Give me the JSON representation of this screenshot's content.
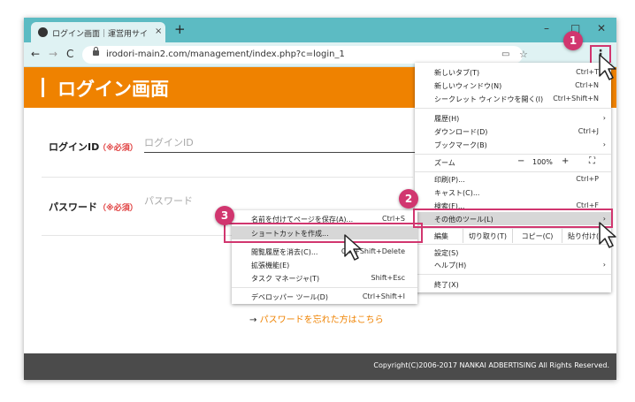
{
  "browser": {
    "tab_title": "ログイン画面｜運営用サイト｜保管",
    "tab_close": "×",
    "new_tab": "+",
    "window_controls": [
      "–",
      "□",
      "✕"
    ],
    "back": "←",
    "forward": "→",
    "reload": "C",
    "url": "irodori-main2.com/management/index.php?c=login_1",
    "star": "☆",
    "cast": "▭",
    "menu_button": "⋮"
  },
  "page": {
    "heading": "ログイン画面",
    "login_id_label": "ログインID",
    "login_id_required": "（※必須）",
    "login_id_placeholder": "ログインID",
    "password_label": "パスワード",
    "password_required": "（※必須）",
    "password_placeholder": "パスワード",
    "forgot_arrow": "→",
    "forgot_link": "パスワードを忘れた方はこちら",
    "footer": "Copyright(C)2006-2017 NANKAI ADBERTISING All Rights Reserved."
  },
  "main_menu": {
    "new_tab": {
      "label": "新しいタブ(T)",
      "shortcut": "Ctrl+T"
    },
    "new_window": {
      "label": "新しいウィンドウ(N)",
      "shortcut": "Ctrl+N"
    },
    "incognito": {
      "label": "シークレット ウィンドウを開く(I)",
      "shortcut": "Ctrl+Shift+N"
    },
    "history": {
      "label": "履歴(H)"
    },
    "downloads": {
      "label": "ダウンロード(D)",
      "shortcut": "Ctrl+J"
    },
    "bookmarks": {
      "label": "ブックマーク(B)"
    },
    "zoom": {
      "label": "ズーム",
      "minus": "−",
      "value": "100%",
      "plus": "+",
      "fullscreen": "⛶"
    },
    "print": {
      "label": "印刷(P)...",
      "shortcut": "Ctrl+P"
    },
    "cast": {
      "label": "キャスト(C)..."
    },
    "find": {
      "label": "検索(F)...",
      "shortcut": "Ctrl+F"
    },
    "more_tools": {
      "label": "その他のツール(L)"
    },
    "edit": {
      "label": "編集",
      "cut": "切り取り(T)",
      "copy": "コピー(C)",
      "paste": "貼り付け(P)"
    },
    "settings": {
      "label": "設定(S)"
    },
    "help": {
      "label": "ヘルプ(H)"
    },
    "exit": {
      "label": "終了(X)"
    },
    "chevron": "›"
  },
  "submenu": {
    "save_page": {
      "label": "名前を付けてページを保存(A)...",
      "shortcut": "Ctrl+S"
    },
    "create_shortcut": {
      "label": "ショートカットを作成..."
    },
    "clear_browsing": {
      "label": "閲覧履歴を消去(C)...",
      "shortcut": "Ctrl+Shift+Delete"
    },
    "extensions": {
      "label": "拡張機能(E)"
    },
    "task_manager": {
      "label": "タスク マネージャ(T)",
      "shortcut": "Shift+Esc"
    },
    "devtools": {
      "label": "デベロッパー ツール(D)",
      "shortcut": "Ctrl+Shift+I"
    }
  },
  "steps": [
    "1",
    "2",
    "3"
  ],
  "colors": {
    "accent": "#d1366f",
    "header_orange": "#ef8200",
    "chrome_teal": "#5cbbc3",
    "footer_gray": "#4b4b4b"
  }
}
